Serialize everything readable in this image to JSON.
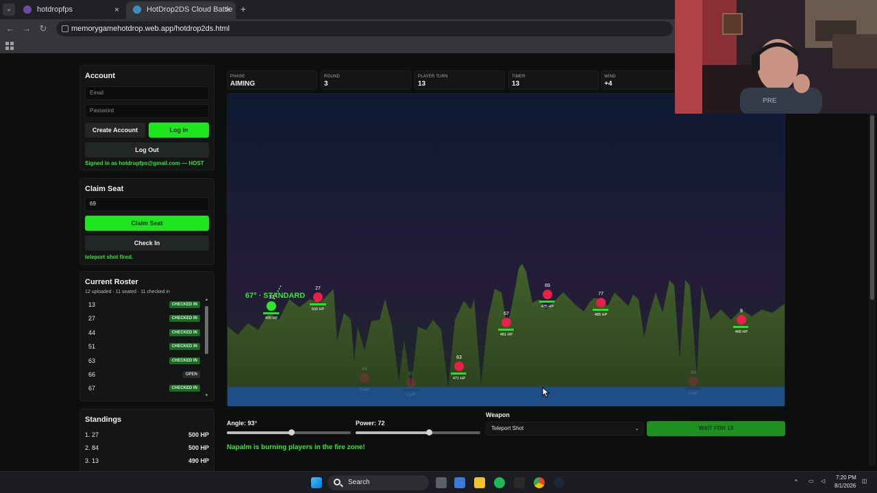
{
  "browser": {
    "tabs": [
      {
        "title": "hotdropfps",
        "close": "×"
      },
      {
        "title": "HotDrop2DS Cloud Battle",
        "close": "×"
      }
    ],
    "new_tab": "+",
    "url": "memorygamehotdrop.web.app/hotdrop2ds.html"
  },
  "account": {
    "title": "Account",
    "email_placeholder": "Email",
    "password_placeholder": "Password",
    "create_label": "Create Account",
    "login_label": "Log In",
    "logout_label": "Log Out",
    "signed_in": "Signed in as hotdropfps@gmail.com — HOST"
  },
  "claim": {
    "title": "Claim Seat",
    "seat_value": "69",
    "claim_label": "Claim Seat",
    "checkin_label": "Check In",
    "status": "teleport shot fired."
  },
  "roster": {
    "title": "Current Roster",
    "meta": "12 uploaded · 11 seated · 11 checked in",
    "rows": [
      {
        "seat": "13",
        "status": "CHECKED IN"
      },
      {
        "seat": "27",
        "status": "CHECKED IN"
      },
      {
        "seat": "44",
        "status": "CHECKED IN"
      },
      {
        "seat": "51",
        "status": "CHECKED IN"
      },
      {
        "seat": "63",
        "status": "CHECKED IN"
      },
      {
        "seat": "66",
        "status": "OPEN"
      },
      {
        "seat": "67",
        "status": "CHECKED IN"
      }
    ]
  },
  "standings": {
    "title": "Standings",
    "rows": [
      {
        "rank": "1. 27",
        "hp": "500 HP"
      },
      {
        "rank": "2. 84",
        "hp": "500 HP"
      },
      {
        "rank": "3. 13",
        "hp": "490 HP"
      }
    ]
  },
  "stats": [
    {
      "key": "PHASE",
      "value": "AIMING"
    },
    {
      "key": "ROUND",
      "value": "3"
    },
    {
      "key": "PLAYER TURN",
      "value": "13"
    },
    {
      "key": "TIMER",
      "value": "13"
    },
    {
      "key": "WIND",
      "value": "+4"
    }
  ],
  "battlefield": {
    "aim_label": "67° · STANDARD",
    "players": [
      {
        "id": "13",
        "hp": "490 HP",
        "hp_frac": 0.98,
        "active": true
      },
      {
        "id": "27",
        "hp": "500 HP",
        "hp_frac": 1.0
      },
      {
        "id": "63",
        "hp": "471 HP",
        "hp_frac": 0.94
      },
      {
        "id": "67",
        "hp": "481 HP",
        "hp_frac": 0.96
      },
      {
        "id": "69",
        "hp": "475 HP",
        "hp_frac": 0.95
      },
      {
        "id": "77",
        "hp": "485 HP",
        "hp_frac": 0.97
      },
      {
        "id": "9",
        "hp": "468 HP",
        "hp_frac": 0.94
      },
      {
        "id": "44",
        "hp": "0 HP",
        "hp_frac": 0,
        "dead": true
      },
      {
        "id": "51",
        "hp": "0 HP",
        "hp_frac": 0,
        "dead": true
      },
      {
        "id": "88",
        "hp": "0 HP",
        "hp_frac": 0,
        "dead": true
      }
    ]
  },
  "controls": {
    "angle_label": "Angle: 93°",
    "angle_frac": 0.52,
    "power_label": "Power: 72",
    "power_frac": 0.59,
    "weapon_label": "Weapon",
    "weapon_value": "Teleport Shot",
    "fire_label": "WAIT FOR 13",
    "message": "Napalm is burning players in the fire zone!"
  },
  "taskbar": {
    "search": "Search",
    "time": "7:20 PM",
    "date": "8/1/2026"
  },
  "colors": {
    "accent": "#1ee61e",
    "player": "#e8204a",
    "terrain": "#3a5a22",
    "water": "#1f4e86"
  }
}
